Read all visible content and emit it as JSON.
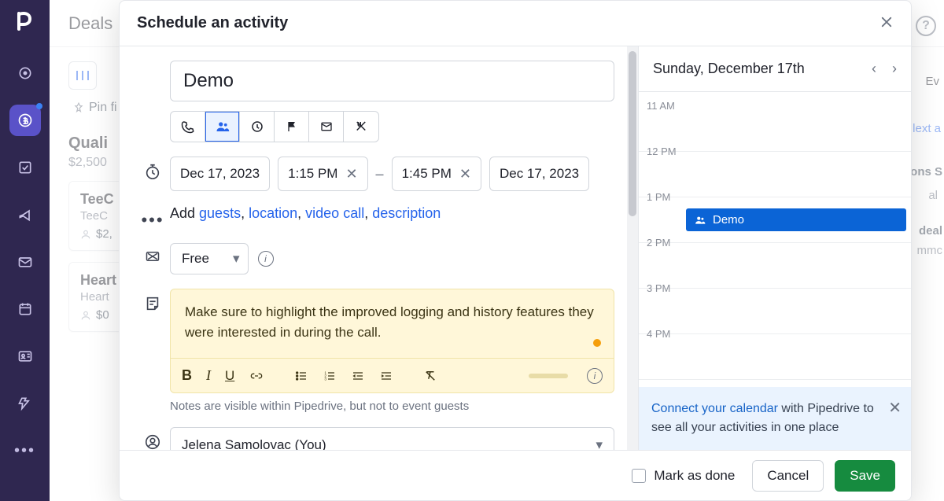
{
  "bg": {
    "header": "Deals",
    "pin": "Pin fi",
    "stage": {
      "name": "Quali",
      "sum": "$2,500"
    },
    "deals": [
      {
        "title": "TeeC",
        "org": "TeeC",
        "amount": "$2,"
      },
      {
        "title": "Heart deal",
        "org": "Heart",
        "amount": "$0"
      }
    ],
    "help": "?",
    "right_slivers": [
      "Ev",
      "lext a",
      "ons S",
      "al",
      "deal",
      "mmc"
    ]
  },
  "modal": {
    "title": "Schedule an activity",
    "activity_title": "Demo",
    "date_start": "Dec 17, 2023",
    "time_start": "1:15 PM",
    "time_end": "1:45 PM",
    "date_end": "Dec 17, 2023",
    "add_prefix": "Add ",
    "add_guests": "guests",
    "add_location": "location",
    "add_video": "video call",
    "add_desc": "description",
    "busy": "Free",
    "note": "Make sure to highlight the improved logging and history features they were interested in during the call.",
    "note_hint": "Notes are visible within Pipedrive, but not to event guests",
    "assignee": "Jelena Samolovac (You)",
    "mark_done": "Mark as done",
    "cancel": "Cancel",
    "save": "Save"
  },
  "calendar": {
    "date": "Sunday, December 17th",
    "hours": [
      "11 AM",
      "12 PM",
      "1 PM",
      "2 PM",
      "3 PM",
      "4 PM"
    ],
    "event": {
      "title": "Demo"
    },
    "banner_link": "Connect your calendar",
    "banner_rest": " with Pipedrive to see all your activities in one place"
  }
}
